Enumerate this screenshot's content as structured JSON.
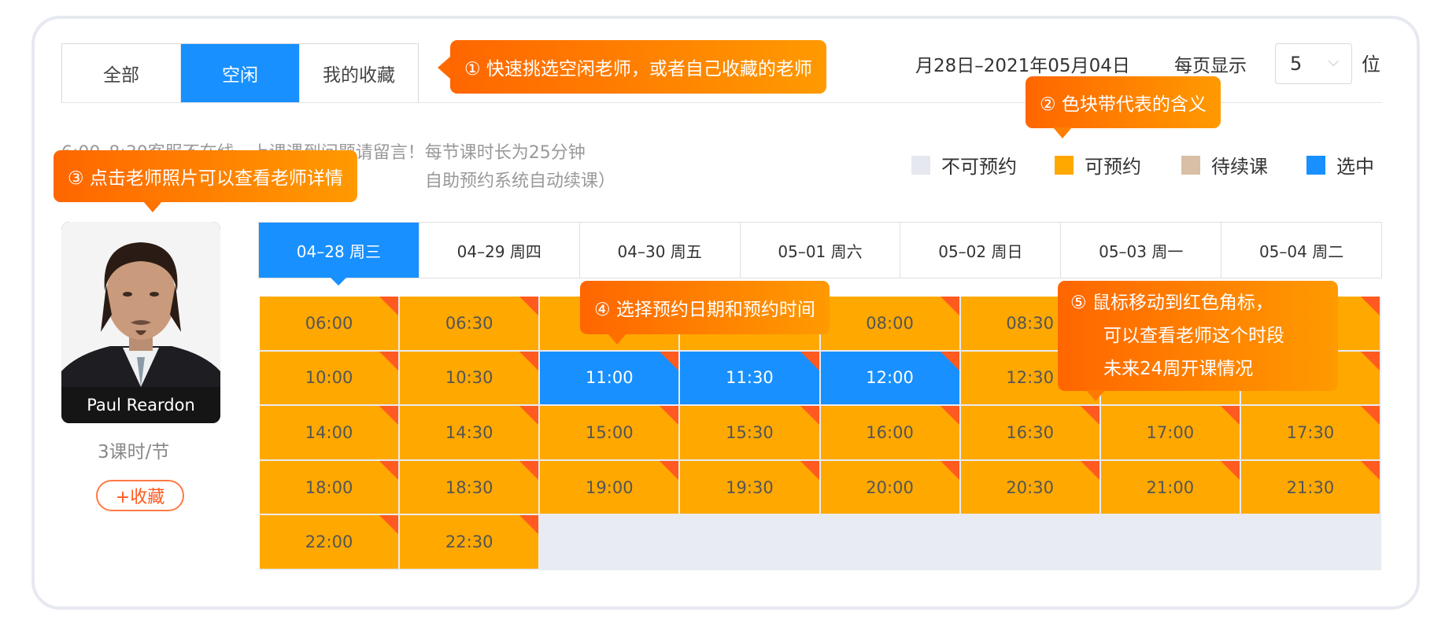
{
  "tabs": [
    {
      "label": "全部",
      "active": false
    },
    {
      "label": "空闲",
      "active": true
    },
    {
      "label": "我的收藏",
      "active": false
    }
  ],
  "date_range": "月28日–2021年05月04日",
  "per_page": {
    "label": "每页显示",
    "value": "5",
    "unit": "位"
  },
  "notes": {
    "line1": "6:00–8:30客服不在线，上课遇到问题请留言！每节课时长为25分钟",
    "line2": "自助预约系统自动续课）"
  },
  "legend": [
    {
      "label": "不可预约",
      "color": "#e6e8ef"
    },
    {
      "label": "可预约",
      "color": "#ffa800"
    },
    {
      "label": "待续课",
      "color": "#d9bfa6"
    },
    {
      "label": "选中",
      "color": "#1890ff"
    }
  ],
  "teacher": {
    "name": "Paul Reardon",
    "hours": "3课时/节",
    "favorite_label": "+收藏"
  },
  "days": [
    {
      "label": "04–28  周三",
      "active": true
    },
    {
      "label": "04–29  周四",
      "active": false
    },
    {
      "label": "04–30  周五",
      "active": false
    },
    {
      "label": "05–01  周六",
      "active": false
    },
    {
      "label": "05–02  周日",
      "active": false
    },
    {
      "label": "05–03  周一",
      "active": false
    },
    {
      "label": "05–04  周二",
      "active": false
    }
  ],
  "slots": [
    [
      "06:00",
      "06:30",
      "",
      "",
      "08:00",
      "08:30",
      "",
      ""
    ],
    [
      "10:00",
      "10:30",
      "11:00",
      "11:30",
      "12:00",
      "12:30",
      "",
      ""
    ],
    [
      "14:00",
      "14:30",
      "15:00",
      "15:30",
      "16:00",
      "16:30",
      "17:00",
      "17:30"
    ],
    [
      "18:00",
      "18:30",
      "19:00",
      "19:30",
      "20:00",
      "20:30",
      "21:00",
      "21:30"
    ],
    [
      "22:00",
      "22:30"
    ]
  ],
  "selected_slots": [
    "11:00",
    "11:30",
    "12:00"
  ],
  "callouts": {
    "c1": "① 快速挑选空闲老师，或者自己收藏的老师",
    "c2": "② 色块带代表的含义",
    "c3": "③ 点击老师照片可以查看老师详情",
    "c4": "④ 选择预约日期和预约时间",
    "c5_line1": "⑤ 鼠标移动到红色角标，",
    "c5_line2": "可以查看老师这个时段",
    "c5_line3": "未来24周开课情况"
  },
  "colors": {
    "accent": "#1890ff",
    "available": "#ffa800",
    "corner": "#ff5a1f",
    "callout": "#ff7a00"
  }
}
